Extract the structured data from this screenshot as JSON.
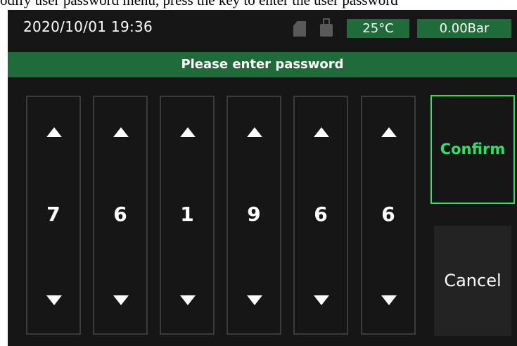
{
  "caption": "odify user password menu, press the key to enter the user password",
  "status_bar": {
    "datetime": "2020/10/01  19:36",
    "temperature": "25°C",
    "pressure": "0.00Bar",
    "icons": [
      "sd-card-icon",
      "usb-drive-icon"
    ],
    "badge_color": "#1f6b3a"
  },
  "title": "Please enter password",
  "digits": [
    "7",
    "6",
    "1",
    "9",
    "6",
    "6"
  ],
  "buttons": {
    "confirm": "Confirm",
    "cancel": "Cancel"
  },
  "colors": {
    "background": "#161616",
    "accent": "#2ee06a",
    "header_green": "#1f6b3a"
  }
}
